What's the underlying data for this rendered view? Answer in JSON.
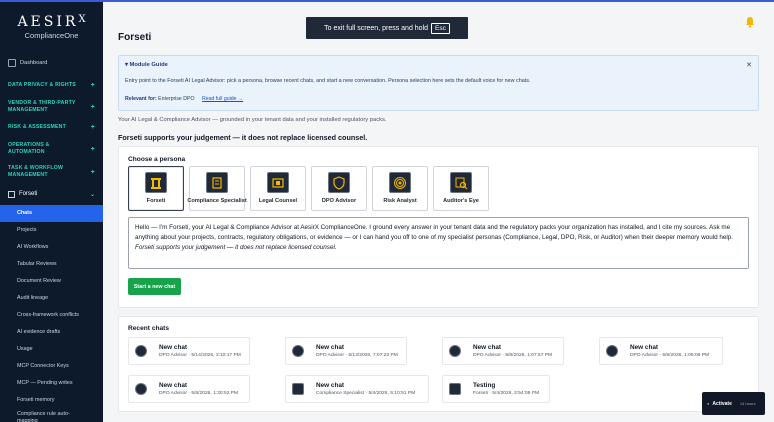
{
  "brand": {
    "name": "AESIR",
    "mark": "X",
    "sub": "ComplianceOne"
  },
  "sidebar": {
    "dashboard": "Dashboard",
    "sections": [
      {
        "label": "DATA PRIVACY & RIGHTS",
        "plus": "+"
      },
      {
        "label": "VENDOR & THIRD-PARTY MANAGEMENT",
        "plus": "+"
      },
      {
        "label": "RISK & ASSESSMENT",
        "plus": "+"
      },
      {
        "label": "OPERATIONS & AUTOMATION",
        "plus": "+"
      },
      {
        "label": "TASK & WORKFLOW MANAGEMENT",
        "plus": "+"
      }
    ],
    "forseti": "Forseti",
    "forseti_chevron": "⌄",
    "sub_items": [
      "Chats",
      "Projects",
      "AI Workflows",
      "Tabular Reviews",
      "Document Review",
      "Audit lineage",
      "Cross-framework conflicts",
      "AI evidence drafts",
      "Usage",
      "MCP Connector Keys",
      "MCP — Pending writes",
      "Forseti memory",
      "Compliance rule auto-mapping"
    ]
  },
  "main": {
    "title": "Forseti",
    "toast": {
      "text": "To exit full screen, press and hold",
      "key": "Esc"
    },
    "guide": {
      "title": "▾ Module Guide",
      "close": "✕",
      "text": "Entry point to the Forseti AI Legal Advisor: pick a persona, browse recent chats, and start a new conversation. Persona selection here sets the default voice for new chats.",
      "relevant_label": "Relevant for:",
      "relevant_value": "Enterprise DPO",
      "link": "Read full guide →"
    },
    "tagline": "Your AI Legal & Compliance Advisor — grounded in your tenant data and your installed regulatory packs.",
    "disclaimer": "Forseti supports your judgement — it does not replace licensed counsel.",
    "choose_persona": "Choose a persona",
    "personas": [
      "Forseti",
      "Compliance Specialist",
      "Legal Counsel",
      "DPO Advisor",
      "Risk Analyst",
      "Auditor's Eye"
    ],
    "intro": {
      "line1": "Hello — I'm Forseti, your AI Legal & Compliance Advisor at AesirX ComplianceOne. I ground every answer in your tenant data and the regulatory packs your organization has installed, and I cite my sources. Ask me anything about your projects, contracts, regulatory obligations, or evidence — or I can hand you off to one of my specialist personas (Compliance, Legal, DPO, Risk, or Auditor) when their deeper memory would help.",
      "line2": "Forseti supports your judgement — it does not replace licensed counsel."
    },
    "start_button": "Start a new chat"
  },
  "recent": {
    "title": "Recent chats",
    "chats": [
      {
        "name": "New chat",
        "meta": "DPO Advisor · 5/14/2026, 3:10:17 PM"
      },
      {
        "name": "New chat",
        "meta": "DPO Advisor · 5/13/2026, 7:07:23 PM"
      },
      {
        "name": "New chat",
        "meta": "DPO Advisor · 5/8/2026, 1:07:57 PM"
      },
      {
        "name": "New chat",
        "meta": "DPO Advisor · 5/8/2026, 1:05:06 PM"
      },
      {
        "name": "New chat",
        "meta": "DPO Advisor · 5/8/2026, 1:30:52 PM"
      },
      {
        "name": "New chat",
        "meta": "Compliance Specialist · 5/4/2026, 5:10:51 PM"
      },
      {
        "name": "Testing",
        "meta": "Forseti · 5/4/2026, 3:54:09 PM"
      }
    ]
  },
  "activate": {
    "dot": "●",
    "label": "Activate",
    "hours": "14 hours"
  }
}
